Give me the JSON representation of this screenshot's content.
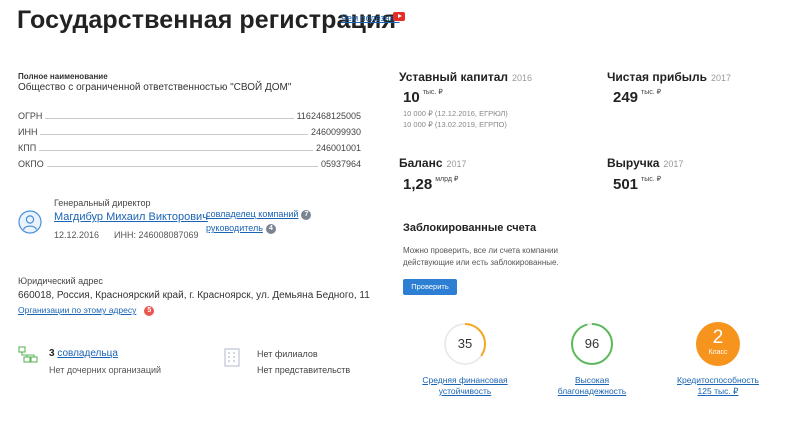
{
  "header": {
    "title": "Государственная регистрация",
    "useful_link": "Чем полезна?",
    "video_icon": "youtube-play-icon"
  },
  "company": {
    "full_name_label": "Полное наименование",
    "full_name": "Общество с ограниченной ответственностью \"СВОЙ ДОМ\"",
    "requisites": [
      {
        "label": "ОГРН",
        "value": "1162468125005"
      },
      {
        "label": "ИНН",
        "value": "2460099930"
      },
      {
        "label": "КПП",
        "value": "246001001"
      },
      {
        "label": "ОКПО",
        "value": "05937964"
      }
    ]
  },
  "director": {
    "role": "Генеральный директор",
    "name": "Магдибур Михаил Викторович",
    "date": "12.12.2016",
    "inn": "ИНН: 246008087069",
    "cofounder_link": "совладелец компаний",
    "cofounder_count": "7",
    "head_link": "руководитель",
    "head_count": "4",
    "avatar_icon": "person-icon"
  },
  "address": {
    "label": "Юридический адрес",
    "value": "660018, Россия, Красноярский край, г. Красноярск, ул. Демьяна Бедного, 11",
    "orgs_link": "Организации по этому адресу",
    "orgs_count": "5"
  },
  "structure": {
    "founders_count": "3",
    "founders_link": "совладельца",
    "subsidiaries": "Нет дочерних организаций",
    "branches": "Нет филиалов",
    "representatives": "Нет представительств"
  },
  "finance": {
    "capital": {
      "title": "Уставный капитал",
      "year": "2016",
      "value": "10",
      "unit": "тыс. ₽",
      "notes": [
        "10 000 ₽ (12.12.2016, ЕГРЮЛ)",
        "10 000 ₽ (13.02.2019, ЕГРПО)"
      ]
    },
    "profit": {
      "title": "Чистая прибыль",
      "year": "2017",
      "value": "249",
      "unit": "тыс. ₽"
    },
    "balance": {
      "title": "Баланс",
      "year": "2017",
      "value": "1,28",
      "unit": "млрд ₽"
    },
    "revenue": {
      "title": "Выручка",
      "year": "2017",
      "value": "501",
      "unit": "тыс. ₽"
    }
  },
  "blocked": {
    "title": "Заблокированные счета",
    "desc_line1": "Можно проверить, все ли счета компании",
    "desc_line2": "действующие или есть заблокированные.",
    "button": "Проверить"
  },
  "ratings": [
    {
      "value": "35",
      "caption1": "Средняя финансовая",
      "caption2": "устойчивость",
      "level": 0.35,
      "color": "#f5a623"
    },
    {
      "value": "96",
      "caption1": "Высокая",
      "caption2": "благонадежность",
      "level": 0.96,
      "color": "#5cb85c"
    },
    {
      "value": "2",
      "class_label": "Класс",
      "caption1": "Кредитоспособность",
      "caption2": "125 тыс. ₽",
      "color": "#f7941d"
    }
  ]
}
